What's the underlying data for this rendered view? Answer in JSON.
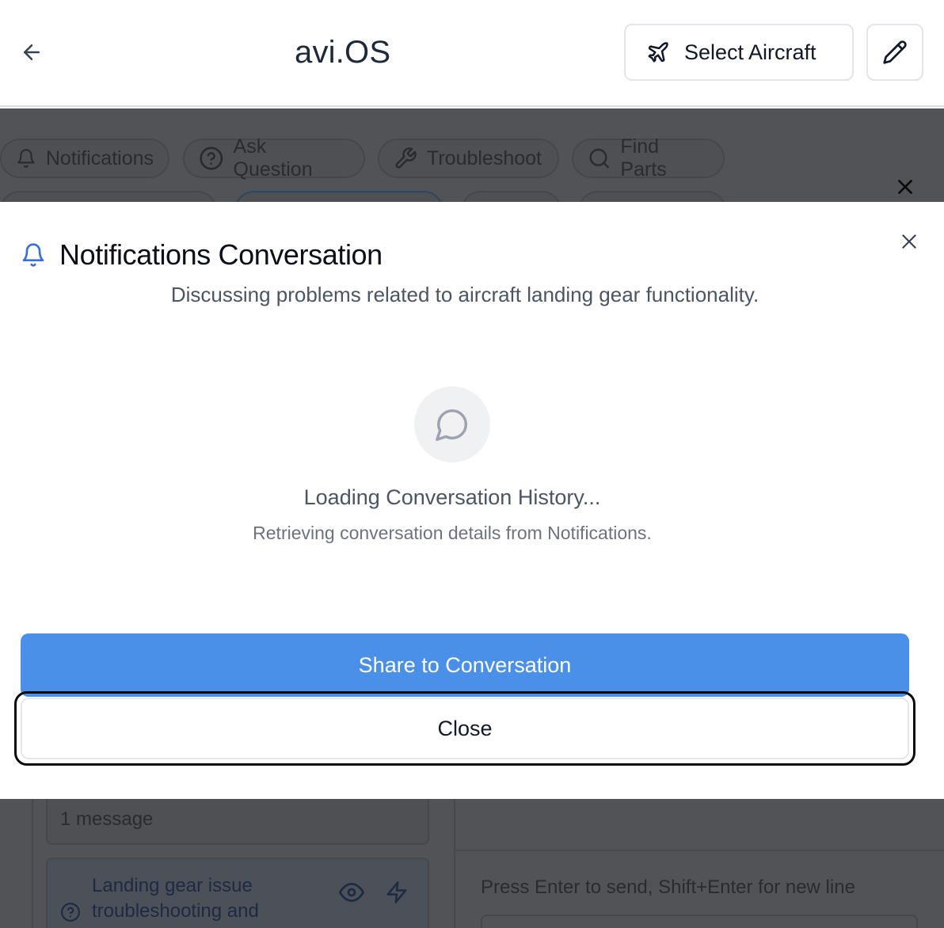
{
  "header": {
    "app_title": "avi.OS",
    "select_aircraft_label": "Select Aircraft"
  },
  "background": {
    "chips": [
      {
        "label": "Notifications",
        "icon": "bell-icon"
      },
      {
        "label": "Ask Question",
        "icon": "question-circle-icon"
      },
      {
        "label": "Troubleshoot",
        "icon": "wrench-icon"
      },
      {
        "label": "Find Parts",
        "icon": "search-icon"
      }
    ],
    "message_count": "1 message",
    "card_title": "Landing gear issue troubleshooting and",
    "input_hint": "Press Enter to send, Shift+Enter for new line"
  },
  "modal": {
    "title": "Notifications Conversation",
    "description": "Discussing problems related to aircraft landing gear functionality.",
    "loading_title": "Loading Conversation History...",
    "loading_subtitle": "Retrieving conversation details from Notifications.",
    "share_label": "Share to Conversation",
    "close_label": "Close"
  },
  "colors": {
    "accent": "#4a90e8",
    "icon_blue": "#3b6fd8",
    "overlay": "#525356"
  }
}
